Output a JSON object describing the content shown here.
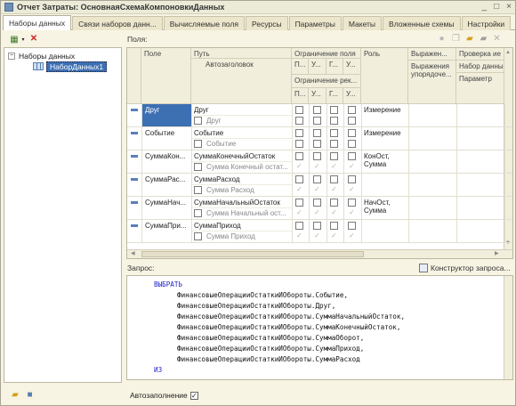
{
  "window": {
    "title": "Отчет Затраты: ОсновнаяСхемаКомпоновкиДанных",
    "controls": [
      "_",
      "□",
      "×"
    ]
  },
  "tabs": [
    "Наборы данных",
    "Связи наборов данн...",
    "Вычисляемые поля",
    "Ресурсы",
    "Параметры",
    "Макеты",
    "Вложенные схемы",
    "Настройки"
  ],
  "tree": {
    "root": "Наборы данных",
    "child": "НаборДанных1"
  },
  "fields_label": "Поля:",
  "grid": {
    "headers": {
      "pole": "Поле",
      "put": "Путь",
      "avto": "Автозаголовок",
      "ogr": "Ограничение поля",
      "ogr_rek": "Ограничение рек...",
      "p": "П...",
      "u": "У...",
      "g": "Г...",
      "u2": "У...",
      "rol": "Роль",
      "vyr": "Выражен...",
      "vyr_sub": "Выражения упорядоче...",
      "prov": "Проверка ие",
      "prov_sub": "Набор данны",
      "param": "Параметр"
    },
    "rows": [
      {
        "pole": "Друг",
        "put": "Друг",
        "avto": "Друг",
        "rol": "Измерение",
        "rol2": ""
      },
      {
        "pole": "Событие",
        "put": "Событие",
        "avto": "Событие",
        "rol": "Измерение",
        "rol2": ""
      },
      {
        "pole": "СуммаКон...",
        "put": "СуммаКонечныйОстаток",
        "avto": "Сумма Конечный остат...",
        "rol": "КонОст,",
        "rol2": "Сумма"
      },
      {
        "pole": "СуммаРас...",
        "put": "СуммаРасход",
        "avto": "Сумма Расход",
        "rol": "",
        "rol2": ""
      },
      {
        "pole": "СуммаНач...",
        "put": "СуммаНачальныйОстаток",
        "avto": "Сумма Начальный ост...",
        "rol": "НачОст,",
        "rol2": "Сумма"
      },
      {
        "pole": "СуммаПри...",
        "put": "СуммаПриход",
        "avto": "Сумма Приход",
        "rol": "",
        "rol2": ""
      }
    ]
  },
  "query_label": "Запрос:",
  "query_builder": "Конструктор запроса...",
  "query": {
    "select": "ВЫБРАТЬ",
    "lines": [
      "ФинансовыеОперацииОстаткиИОбороты.Событие,",
      "ФинансовыеОперацииОстаткиИОбороты.Друг,",
      "ФинансовыеОперацииОстаткиИОбороты.СуммаНачальныйОстаток,",
      "ФинансовыеОперацииОстаткиИОбороты.СуммаКонечныйОстаток,",
      "ФинансовыеОперацииОстаткиИОбороты.СуммаОборот,",
      "ФинансовыеОперацииОстаткиИОбороты.СуммаПриход,",
      "ФинансовыеОперацииОстаткиИОбороты.СуммаРасход"
    ],
    "from": "ИЗ"
  },
  "autofill": {
    "label": "Автозаполнение",
    "checked": "✓"
  }
}
